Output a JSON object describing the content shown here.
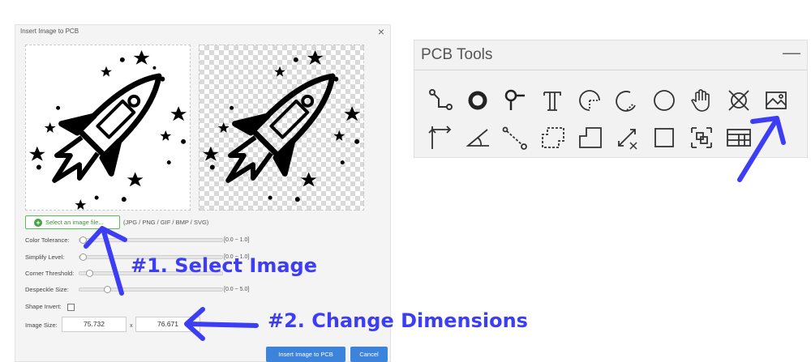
{
  "dialog": {
    "title": "Insert Image to PCB",
    "close_glyph": "×",
    "select_button_label": "Select an image file...",
    "formats_hint": "(JPG / PNG / GIF / BMP / SVG)",
    "color_tolerance": {
      "label": "Color Tolerance:",
      "range": "[0.0 ~ 1.0]",
      "level": 0.0
    },
    "simplify_level": {
      "label": "Simplify Level:",
      "range": "[0.0 ~ 1.0]",
      "level": 0.0
    },
    "corner_threshold": {
      "label": "Corner Threshold:",
      "range": "",
      "level": 0.05
    },
    "despeckle_size": {
      "label": "Despeckle Size:",
      "range": "[0.0 ~ 5.0]",
      "level": 0.18
    },
    "shape_invert": {
      "label": "Shape Invert:",
      "checked": false
    },
    "image_size": {
      "label": "Image Size:",
      "width": "75.732",
      "separator": "x",
      "height": "76.671"
    },
    "insert_button_label": "Insert Image to PCB",
    "cancel_button_label": "Cancel"
  },
  "pcb_tools": {
    "title": "PCB Tools",
    "minimize_glyph": "—",
    "tools": [
      "track-icon",
      "pad-icon",
      "via-icon",
      "text-icon",
      "arc-icon",
      "arc-ccw-icon",
      "circle-icon",
      "pan-hand-icon",
      "hole-icon",
      "image-icon",
      "dimension-icon",
      "angle-icon",
      "connect-pad-icon",
      "copper-area-icon",
      "solid-region-icon",
      "canvas-origin-icon",
      "rectangle-icon",
      "group-icon",
      "table-icon"
    ]
  },
  "annotations": {
    "step1": "#1. Select Image",
    "step2": "#2. Change Dimensions"
  },
  "colors": {
    "annotation": "#3d3df5",
    "select_button_border": "#5cb85c",
    "primary_button": "#3c83db"
  }
}
